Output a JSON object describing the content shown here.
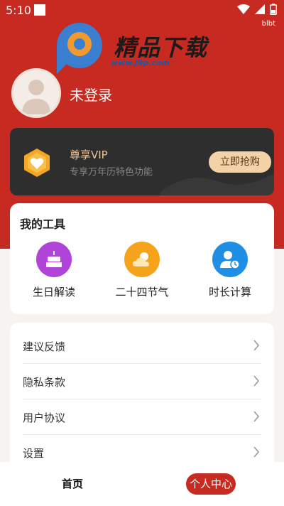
{
  "status_bar": {
    "time": "5:10",
    "ext_label": "blbt"
  },
  "watermark": {
    "brand_cn": "精品下载",
    "url": "www.j9p.com"
  },
  "profile": {
    "username": "未登录"
  },
  "vip": {
    "title": "尊享VIP",
    "subtitle": "专享万年历特色功能",
    "button_label": "立即抢购"
  },
  "tools": {
    "title": "我的工具",
    "items": [
      {
        "label": "生日解读",
        "icon": "cake-icon",
        "color": "#b144d8"
      },
      {
        "label": "二十四节气",
        "icon": "sun-cloud-icon",
        "color": "#f5a31a"
      },
      {
        "label": "时长计算",
        "icon": "user-clock-icon",
        "color": "#1f8fe6"
      }
    ]
  },
  "menu": {
    "items": [
      {
        "label": "建议反馈"
      },
      {
        "label": "隐私条款"
      },
      {
        "label": "用户协议"
      },
      {
        "label": "设置"
      }
    ]
  },
  "bottom_nav": {
    "home_label": "首页",
    "profile_label": "个人中心",
    "active": "个人中心"
  },
  "colors": {
    "brand_red": "#c72a20",
    "vip_gold": "#e8c39a",
    "vip_button": "#f3d2a8"
  }
}
